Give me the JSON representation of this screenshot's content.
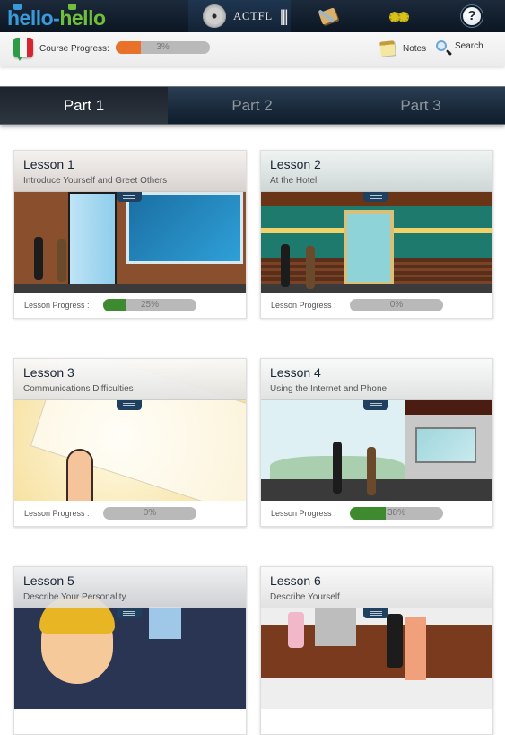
{
  "app": {
    "logo_part1": "hello",
    "logo_dash": "-",
    "logo_part2": "hello",
    "partner_label": "ACTFL",
    "partner_bars": "|||"
  },
  "nav_icons": {
    "lesson": "lessons-book-icon",
    "settings": "settings-gears-icon",
    "help": "help-question-icon",
    "help_glyph": "?"
  },
  "course": {
    "language_flag": "italian-flag",
    "progress_label": "Course Progress:",
    "progress_value": 3,
    "progress_text": "3%"
  },
  "toolbar": {
    "notes_label": "Notes",
    "search_label": "Search"
  },
  "tabs": [
    {
      "label": "Part 1",
      "active": true
    },
    {
      "label": "Part 2",
      "active": false
    },
    {
      "label": "Part 3",
      "active": false
    }
  ],
  "lesson_progress_label": "Lesson Progress :",
  "lessons": [
    {
      "title": "Lesson 1",
      "subtitle": "Introduce Yourself and Greet Others",
      "progress": 25,
      "progress_text": "25%",
      "scene": "cafe"
    },
    {
      "title": "Lesson 2",
      "subtitle": "At the Hotel",
      "progress": 0,
      "progress_text": "0%",
      "scene": "hotel"
    },
    {
      "title": "Lesson 3",
      "subtitle": "Communications Difficulties",
      "progress": 0,
      "progress_text": "0%",
      "scene": "business-card"
    },
    {
      "title": "Lesson 4",
      "subtitle": "Using the Internet and Phone",
      "progress": 38,
      "progress_text": "38%",
      "scene": "street"
    },
    {
      "title": "Lesson 5",
      "subtitle": "Describe Your Personality",
      "scene": "video-call"
    },
    {
      "title": "Lesson 6",
      "subtitle": "Describe Yourself",
      "scene": "office"
    }
  ],
  "colors": {
    "course_progress": "#e8722a",
    "lesson_progress": "#3e8a2e",
    "progress_track": "#b9b9b9"
  }
}
